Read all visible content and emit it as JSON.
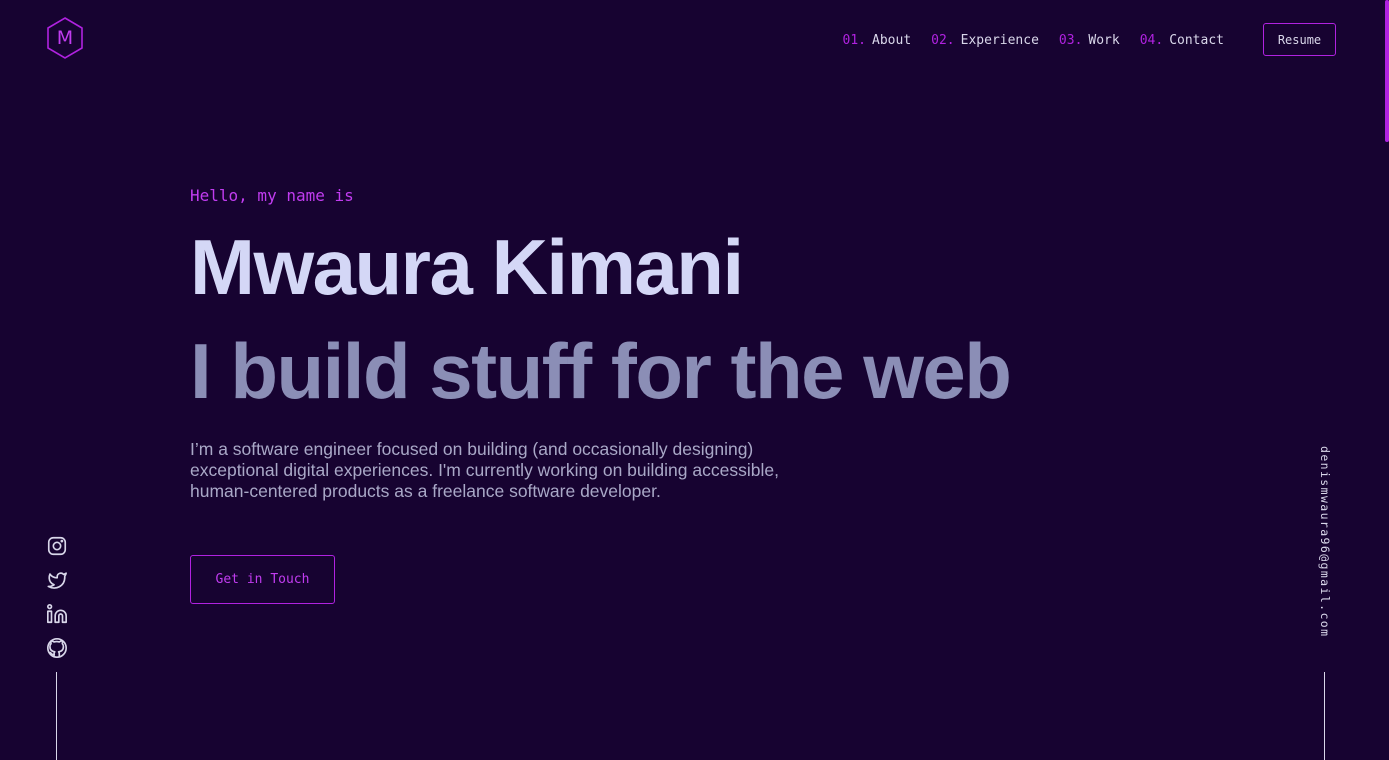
{
  "logo": {
    "letter": "M",
    "icon": "hexagon-logo-icon",
    "color": "#b022e0"
  },
  "nav": {
    "items": [
      {
        "num": "01.",
        "label": "About"
      },
      {
        "num": "02.",
        "label": "Experience"
      },
      {
        "num": "03.",
        "label": "Work"
      },
      {
        "num": "04.",
        "label": "Contact"
      }
    ],
    "resume_label": "Resume"
  },
  "hero": {
    "greeting": "Hello, my name is",
    "name": "Mwaura Kimani",
    "tagline": "I build stuff for the web",
    "bio": "I’m a software engineer focused on building (and occasionally designing) exceptional digital experiences. I'm currently working on building accessible, human-centered products as a freelance software developer.",
    "cta_label": "Get in Touch"
  },
  "socials": [
    {
      "name": "instagram",
      "icon": "instagram-icon"
    },
    {
      "name": "twitter",
      "icon": "twitter-icon"
    },
    {
      "name": "linkedin",
      "icon": "linkedin-icon"
    },
    {
      "name": "github",
      "icon": "github-icon"
    }
  ],
  "email": "denismwaura96@gmail.com",
  "colors": {
    "background": "#170331",
    "accent": "#b022e0",
    "heading": "#d4d7f6",
    "subheading": "#8b8eb6",
    "body_text": "#a9a8c7"
  }
}
